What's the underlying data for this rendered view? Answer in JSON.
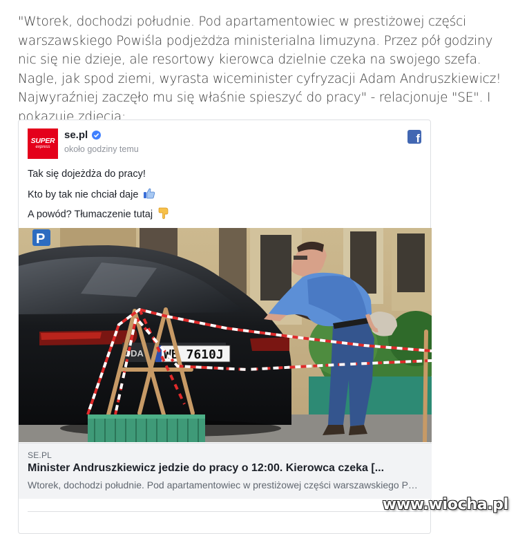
{
  "article": {
    "text": "\"Wtorek, dochodzi południe. Pod apartamentowiec w prestiżowej części warszawskiego Powiśla podjeżdża ministerialna limuzyna. Przez pół godziny nic się nie dzieje, ale resortowy kierowca dzielnie czeka na swojego szefa. Nagle, jak spod ziemi, wyrasta wiceminister cyfryzacji Adam Andruszkiewicz! Najwyraźniej zaczęło mu się właśnie spieszyć do pracy\" - relacjonuje \"SE\". I pokazuje zdjęcia:"
  },
  "post": {
    "logo_line1": "SUPER",
    "logo_line2": "express",
    "page_name": "se.pl",
    "timestamp": "około godziny temu",
    "lines": [
      "Tak się dojeżdża do pracy!",
      "Kto by tak nie chciał daje",
      "A powód? Tłumaczenie tutaj"
    ],
    "icons": {
      "verified": "verified-badge-icon",
      "facebook": "facebook-icon",
      "thumbs_up": "thumbs-up-emoji",
      "pointing_down": "pointing-down-emoji"
    },
    "photo": {
      "plate_text": "WB 7610J",
      "badge_text": "ODA",
      "sign_text": "P"
    },
    "link_preview": {
      "domain": "SE.PL",
      "title": "Minister Andruszkiewicz jedzie do pracy o 12:00. Kierowca czeka [...",
      "description": "Wtorek, dochodzi południe. Pod apartamentowiec w prestiżowej części warszawskiego Powiśla"
    }
  },
  "watermark": "www.wiocha.pl",
  "colors": {
    "facebook_blue": "#4267b2",
    "brand_red": "#e4001b",
    "verified_blue": "#4080ff",
    "text_gray": "#3b3b3b"
  }
}
